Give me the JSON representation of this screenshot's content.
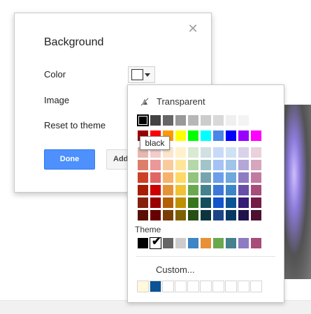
{
  "dialog": {
    "title": "Background",
    "close_symbol": "✕",
    "color_label": "Color",
    "image_label": "Image",
    "reset_label": "Reset to theme",
    "selected_color": "#ffffff",
    "done_label": "Done",
    "add_label": "Add"
  },
  "palette": {
    "transparent_label": "Transparent",
    "transparent_icon": "slash-droplet-icon",
    "grays": [
      "#000000",
      "#434343",
      "#666666",
      "#999999",
      "#b7b7b7",
      "#cccccc",
      "#d9d9d9",
      "#efefef",
      "#f3f3f3",
      "#ffffff"
    ],
    "grays_selected_index": 0,
    "brights": [
      "#980000",
      "#ff0000",
      "#ff9900",
      "#ffff00",
      "#00ff00",
      "#00ffff",
      "#4a86e8",
      "#0000ff",
      "#9900ff",
      "#ff00ff"
    ],
    "shades": [
      [
        "#e6b8af",
        "#f4cccc",
        "#fce5cd",
        "#fff2cc",
        "#d9ead3",
        "#d0e0e3",
        "#c9daf8",
        "#cfe2f3",
        "#d9d2e9",
        "#ead1dc"
      ],
      [
        "#dd7e6b",
        "#ea9999",
        "#f9cb9c",
        "#ffe599",
        "#b6d7a8",
        "#a2c4c9",
        "#a4c2f4",
        "#9fc5e8",
        "#b4a7d6",
        "#d5a6bd"
      ],
      [
        "#cc4125",
        "#e06666",
        "#f6b26b",
        "#ffd966",
        "#93c47d",
        "#76a5af",
        "#6d9eeb",
        "#6fa8dc",
        "#8e7cc3",
        "#c27ba0"
      ],
      [
        "#a61c00",
        "#cc0000",
        "#e69138",
        "#f1c232",
        "#6aa84f",
        "#45818e",
        "#3c78d8",
        "#3d85c6",
        "#674ea7",
        "#a64d79"
      ],
      [
        "#85200c",
        "#990000",
        "#b45f06",
        "#bf9000",
        "#38761d",
        "#134f5c",
        "#1155cc",
        "#0b5394",
        "#351c75",
        "#741b47"
      ],
      [
        "#5b0f00",
        "#660000",
        "#783f04",
        "#7f6000",
        "#274e13",
        "#0c343d",
        "#1c4587",
        "#073763",
        "#20124d",
        "#4c1130"
      ]
    ],
    "theme_label": "Theme",
    "theme_colors": [
      "#000000",
      "#ffffff",
      "#666666",
      "#cccccc",
      "#3d85c6",
      "#e69138",
      "#6aa84f",
      "#45818e",
      "#8e7cc3",
      "#a64d79"
    ],
    "theme_selected_index": 1,
    "check_symbol": "✔",
    "custom_label": "Custom...",
    "custom_colors": [
      "#fff8dc",
      "#0b5394",
      "#ffffff",
      "#ffffff",
      "#ffffff",
      "#ffffff",
      "#ffffff",
      "#ffffff",
      "#ffffff",
      "#ffffff"
    ]
  },
  "tooltip": {
    "text": "black"
  }
}
